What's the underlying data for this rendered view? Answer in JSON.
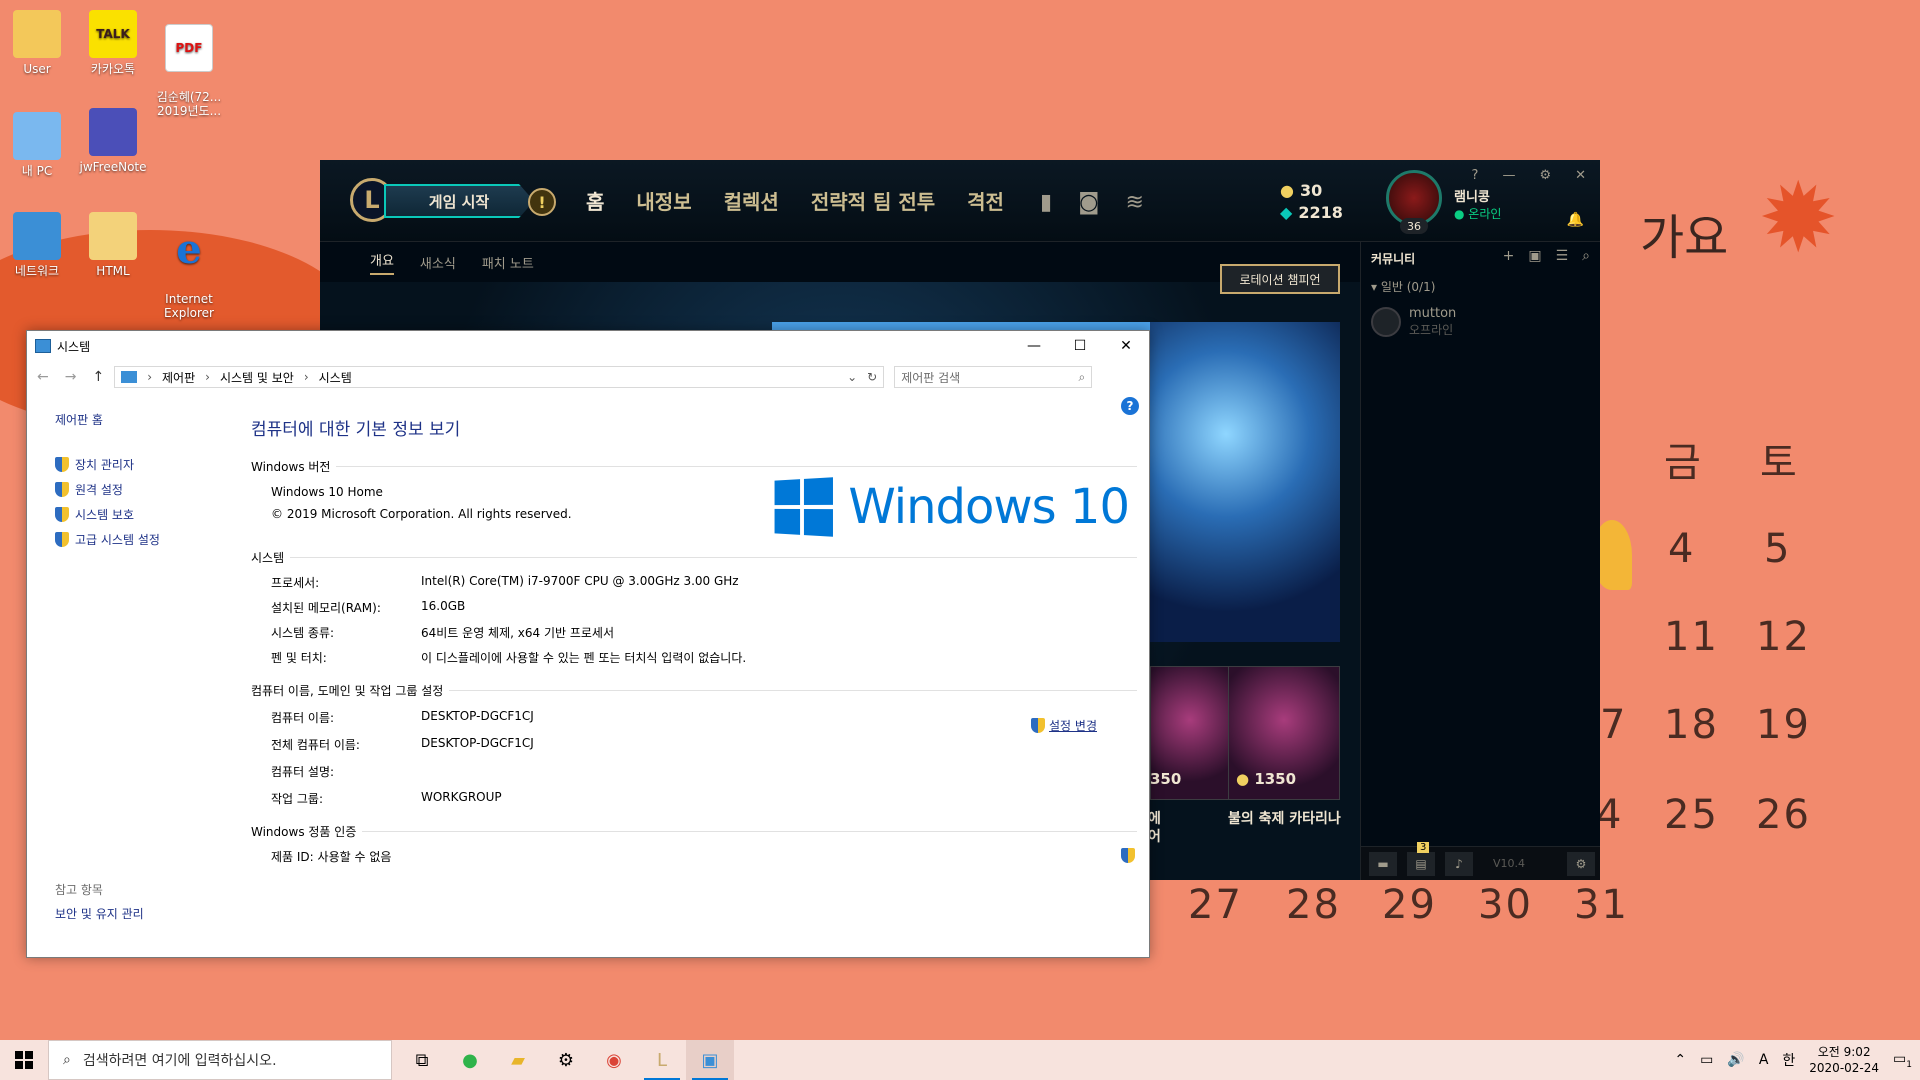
{
  "wallpaper": {
    "title": "가요",
    "calendar_rows": [
      [
        "금",
        "토"
      ],
      [
        "4",
        "5"
      ],
      [
        "11",
        "12"
      ],
      [
        "18",
        "19"
      ],
      [
        "25",
        "26"
      ],
      [
        "27",
        "28",
        "29",
        "30",
        "31"
      ]
    ],
    "partial_left": [
      "7",
      "4"
    ]
  },
  "desktop_icons": [
    {
      "label": "User",
      "icon": "folder-user-icon"
    },
    {
      "label": "카카오톡",
      "icon": "kakaotalk-icon",
      "glyph": "TALK"
    },
    {
      "label": "김순혜(72...\n2019년도...",
      "icon": "pdf-icon",
      "glyph": "PDF"
    },
    {
      "label": "내 PC",
      "icon": "computer-icon"
    },
    {
      "label": "jwFreeNote",
      "icon": "notebook-icon"
    },
    {
      "label": "네트워크",
      "icon": "network-icon"
    },
    {
      "label": "HTML",
      "icon": "folder-icon"
    },
    {
      "label": "Internet\nExplorer",
      "icon": "ie-icon",
      "glyph": "e"
    }
  ],
  "lol": {
    "play_label": "게임 시작",
    "alert_glyph": "!",
    "nav": [
      "홈",
      "내정보",
      "컬렉션",
      "전략적 팀 전투",
      "격전"
    ],
    "currency_rp": "30",
    "currency_be": "2218",
    "level": "36",
    "summoner_name": "램니콩",
    "summoner_status": "온라인",
    "subnav": [
      "개요",
      "새소식",
      "패치 노트"
    ],
    "rotation_button": "로테이션 챔피언",
    "skin_price_1": "350",
    "skin_price_2": "1350",
    "skin_name_2": "불의 축제 카타리나",
    "skin_name_1_part": "에",
    "skin_name_1_part2": "어",
    "social_title": "커뮤니티",
    "social_group": "일반 (0/1)",
    "friend_name": "mutton",
    "friend_status": "오프라인",
    "notif_count": "3",
    "version": "V10.4",
    "colors": {
      "gold": "#c8aa6e",
      "teal": "#0ac8b9",
      "online": "#0ace83"
    }
  },
  "system": {
    "window_title": "시스템",
    "breadcrumb": [
      "제어판",
      "시스템 및 보안",
      "시스템"
    ],
    "search_placeholder": "제어판 검색",
    "left_home": "제어판 홈",
    "left_links": [
      "장치 관리자",
      "원격 설정",
      "시스템 보호",
      "고급 시스템 설정"
    ],
    "see_also": "참고 항목",
    "security_link": "보안 및 유지 관리",
    "page_title": "컴퓨터에 대한 기본 정보 보기",
    "sections": {
      "edition": {
        "header": "Windows 버전",
        "lines": [
          "Windows 10 Home",
          "© 2019 Microsoft Corporation. All rights reserved."
        ]
      },
      "system": {
        "header": "시스템",
        "rows": [
          {
            "k": "프로세서:",
            "v": "Intel(R) Core(TM) i7-9700F CPU @ 3.00GHz   3.00 GHz"
          },
          {
            "k": "설치된 메모리(RAM):",
            "v": "16.0GB"
          },
          {
            "k": "시스템 종류:",
            "v": "64비트 운영 체제, x64 기반 프로세서"
          },
          {
            "k": "펜 및 터치:",
            "v": "이 디스플레이에 사용할 수 있는 펜 또는 터치식 입력이 없습니다."
          }
        ]
      },
      "computer": {
        "header": "컴퓨터 이름, 도메인 및 작업 그룹 설정",
        "rows": [
          {
            "k": "컴퓨터 이름:",
            "v": "DESKTOP-DGCF1CJ"
          },
          {
            "k": "전체 컴퓨터 이름:",
            "v": "DESKTOP-DGCF1CJ"
          },
          {
            "k": "컴퓨터 설명:",
            "v": ""
          },
          {
            "k": "작업 그룹:",
            "v": "WORKGROUP"
          }
        ],
        "change_link": "설정 변경"
      },
      "activation": {
        "header": "Windows 정품 인증",
        "line": "제품 ID: 사용할 수 없음"
      }
    },
    "logo_text": "Windows 10",
    "accent": "#0078d7"
  },
  "taskbar": {
    "search_placeholder": "검색하려면 여기에 입력하십시오.",
    "apps": [
      "task-view-icon",
      "green-app-icon",
      "file-explorer-icon",
      "settings-icon",
      "chrome-icon",
      "league-icon",
      "control-panel-icon"
    ],
    "ime_a": "A",
    "ime_han": "한",
    "time": "오전 9:02",
    "date": "2020-02-24",
    "notification_count": "1"
  }
}
